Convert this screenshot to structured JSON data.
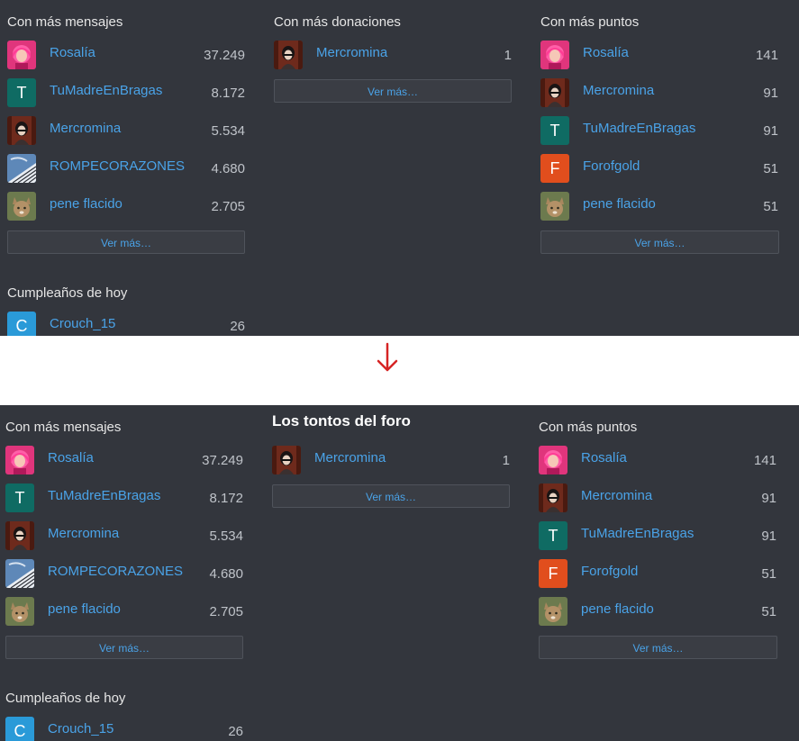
{
  "colors": {
    "panel_bg": "#33363d",
    "link": "#4aa3e8",
    "arrow": "#d62424"
  },
  "top": {
    "messages": {
      "title": "Con más mensajes",
      "rows": [
        {
          "name": "Rosalía",
          "count": "37.249",
          "avatar": "pink-hair-avatar"
        },
        {
          "name": "TuMadreEnBragas",
          "count": "8.172",
          "avatar": "T"
        },
        {
          "name": "Mercromina",
          "count": "5.534",
          "avatar": "dark-girl-avatar"
        },
        {
          "name": "ROMPECORAZONES",
          "count": "4.680",
          "avatar": "piano-avatar"
        },
        {
          "name": "pene flacido",
          "count": "2.705",
          "avatar": "cat-avatar"
        }
      ],
      "more_label": "Ver más…"
    },
    "donations": {
      "title": "Con más donaciones",
      "rows": [
        {
          "name": "Mercromina",
          "count": "1",
          "avatar": "dark-girl-avatar"
        }
      ],
      "more_label": "Ver más…"
    },
    "points": {
      "title": "Con más puntos",
      "rows": [
        {
          "name": "Rosalía",
          "count": "141",
          "avatar": "pink-hair-avatar"
        },
        {
          "name": "Mercromina",
          "count": "91",
          "avatar": "dark-girl-avatar"
        },
        {
          "name": "TuMadreEnBragas",
          "count": "91",
          "avatar": "T"
        },
        {
          "name": "Forofgold",
          "count": "51",
          "avatar": "F"
        },
        {
          "name": "pene flacido",
          "count": "51",
          "avatar": "cat-avatar"
        }
      ],
      "more_label": "Ver más…"
    },
    "birthdays": {
      "title": "Cumpleaños de hoy",
      "rows": [
        {
          "name": "Crouch_15",
          "count": "26",
          "avatar": "C"
        }
      ]
    }
  },
  "bottom": {
    "messages": {
      "title": "Con más mensajes",
      "rows": [
        {
          "name": "Rosalía",
          "count": "37.249",
          "avatar": "pink-hair-avatar"
        },
        {
          "name": "TuMadreEnBragas",
          "count": "8.172",
          "avatar": "T"
        },
        {
          "name": "Mercromina",
          "count": "5.534",
          "avatar": "dark-girl-avatar"
        },
        {
          "name": "ROMPECORAZONES",
          "count": "4.680",
          "avatar": "piano-avatar"
        },
        {
          "name": "pene flacido",
          "count": "2.705",
          "avatar": "cat-avatar"
        }
      ],
      "more_label": "Ver más…"
    },
    "donations": {
      "title": "Los tontos del foro",
      "rows": [
        {
          "name": "Mercromina",
          "count": "1",
          "avatar": "dark-girl-avatar"
        }
      ],
      "more_label": "Ver más…"
    },
    "points": {
      "title": "Con más puntos",
      "rows": [
        {
          "name": "Rosalía",
          "count": "141",
          "avatar": "pink-hair-avatar"
        },
        {
          "name": "Mercromina",
          "count": "91",
          "avatar": "dark-girl-avatar"
        },
        {
          "name": "TuMadreEnBragas",
          "count": "91",
          "avatar": "T"
        },
        {
          "name": "Forofgold",
          "count": "51",
          "avatar": "F"
        },
        {
          "name": "pene flacido",
          "count": "51",
          "avatar": "cat-avatar"
        }
      ],
      "more_label": "Ver más…"
    },
    "birthdays": {
      "title": "Cumpleaños de hoy",
      "rows": [
        {
          "name": "Crouch_15",
          "count": "26",
          "avatar": "C"
        }
      ]
    }
  }
}
